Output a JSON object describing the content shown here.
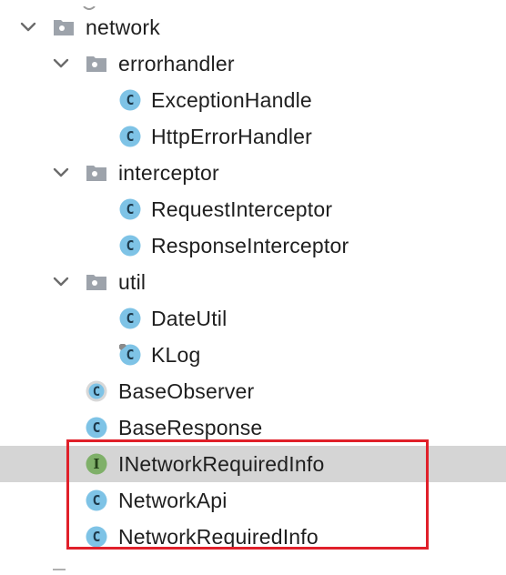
{
  "tree": {
    "rows": [
      {
        "label": "network",
        "kind": "package",
        "expanded": true
      },
      {
        "label": "errorhandler",
        "kind": "package",
        "expanded": true
      },
      {
        "label": "ExceptionHandle",
        "kind": "class"
      },
      {
        "label": "HttpErrorHandler",
        "kind": "class"
      },
      {
        "label": "interceptor",
        "kind": "package",
        "expanded": true
      },
      {
        "label": "RequestInterceptor",
        "kind": "class"
      },
      {
        "label": "ResponseInterceptor",
        "kind": "class"
      },
      {
        "label": "util",
        "kind": "package",
        "expanded": true
      },
      {
        "label": "DateUtil",
        "kind": "class"
      },
      {
        "label": "KLog",
        "kind": "class-pinned"
      },
      {
        "label": "BaseObserver",
        "kind": "class-abstract"
      },
      {
        "label": "BaseResponse",
        "kind": "class"
      },
      {
        "label": "INetworkRequiredInfo",
        "kind": "interface",
        "selected": true
      },
      {
        "label": "NetworkApi",
        "kind": "class"
      },
      {
        "label": "NetworkRequiredInfo",
        "kind": "class"
      }
    ]
  },
  "colors": {
    "class_icon": "#7ec3e6",
    "interface_icon": "#7fb069",
    "folder_icon": "#9da3ab",
    "selection": "#d5d5d5",
    "highlight_border": "#e0202a",
    "chevron": "#6b6b6b"
  }
}
